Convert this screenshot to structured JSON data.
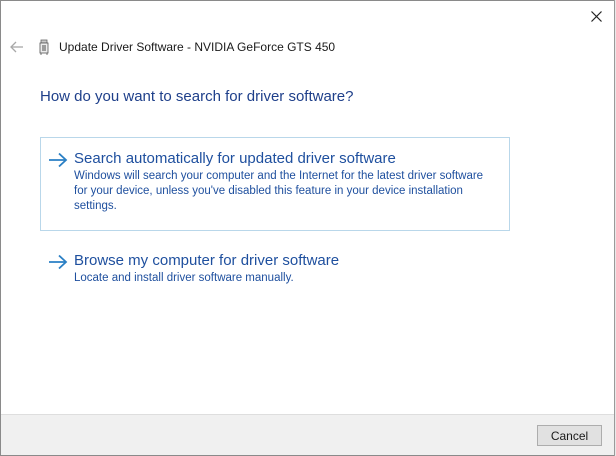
{
  "window": {
    "title": "Update Driver Software - NVIDIA GeForce GTS 450"
  },
  "heading": "How do you want to search for driver software?",
  "options": [
    {
      "title": "Search automatically for updated driver software",
      "description": "Windows will search your computer and the Internet for the latest driver software for your device, unless you've disabled this feature in your device installation settings.",
      "icon": "arrow-right-icon"
    },
    {
      "title": "Browse my computer for driver software",
      "description": "Locate and install driver software manually.",
      "icon": "arrow-right-icon"
    }
  ],
  "footer": {
    "cancel_label": "Cancel"
  },
  "colors": {
    "heading": "#1e3f8a",
    "link": "#1e4f9e",
    "arrow": "#2a7fc4",
    "selected_border": "#b9d7ea",
    "footer_bg": "#f0f0f0"
  },
  "icons": {
    "close": "close-icon",
    "back": "back-arrow-icon",
    "device": "device-icon"
  }
}
